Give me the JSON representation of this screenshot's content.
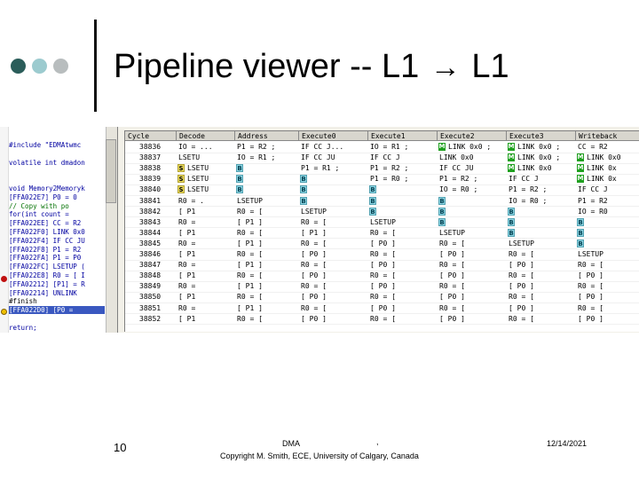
{
  "slide": {
    "title_left": "Pipeline viewer  -- L1",
    "title_arrow": "→",
    "title_right": "L1",
    "dot_colors": [
      "#2b5d5a",
      "#9ccbcf",
      "#b8bdbe"
    ]
  },
  "editor": {
    "lines": [
      {
        "text": "#include \"EDMAtwmc",
        "style": "blue"
      },
      {
        "text": "",
        "style": ""
      },
      {
        "text": "volatile int dmadon",
        "style": "blue"
      },
      {
        "text": "",
        "style": ""
      },
      {
        "text": "",
        "style": ""
      },
      {
        "text": "void Memory2Memoryk",
        "style": "blue"
      },
      {
        "text": "[FFA022E7] P0 = 0",
        "style": "blue"
      },
      {
        "text": "   // Copy with po",
        "style": "green"
      },
      {
        "text": "   for(int count =",
        "style": "blue"
      },
      {
        "text": "[FFA022EE] CC = R2",
        "style": "blue"
      },
      {
        "text": "[FFA022F0] LINK 0x0",
        "style": "blue"
      },
      {
        "text": "[FFA022F4] IF CC JU",
        "style": "blue"
      },
      {
        "text": "[FFA022F8] P1 = R2",
        "style": "blue"
      },
      {
        "text": "[FFA022FA] P1 = P0",
        "style": "blue"
      },
      {
        "text": "[FFA022FC] LSETUP (",
        "style": "blue"
      },
      {
        "text": "[FFA022E8] R0 = [ I",
        "style": "blue"
      },
      {
        "text": "[FFA02212] [P1] = R",
        "style": "blue"
      },
      {
        "text": "[FFA02214] UNLINK",
        "style": "blue"
      },
      {
        "text": "   #finish",
        "style": ""
      },
      {
        "text": "[FFA022D0] [P0 = ",
        "style": "sel"
      },
      {
        "text": "",
        "style": ""
      },
      {
        "text": "   return;",
        "style": "blue"
      }
    ]
  },
  "pipeline": {
    "headers": [
      "Cycle",
      "Decode",
      "Address",
      "Execute0",
      "Execute1",
      "Execute2",
      "Execute3",
      "Writeback"
    ],
    "rows": [
      {
        "cycle": "38836",
        "tags": [
          "",
          "",
          "",
          "",
          "",
          "M",
          "M",
          ""
        ],
        "cells": [
          "",
          "IO = ...",
          "P1 = R2 ;",
          "IF CC J...",
          "IO = R1 ;",
          "LINK 0x0 ;",
          "LINK 0x0 ;",
          "CC = R2"
        ]
      },
      {
        "cycle": "38837",
        "tags": [
          "",
          "",
          "",
          "",
          "",
          "",
          "M",
          "M"
        ],
        "cells": [
          "",
          "LSETU",
          "IO = R1 ;",
          "IF CC JU",
          "IF CC J",
          "LINK 0x0",
          "LINK 0x0 ;",
          "LINK 0x0"
        ]
      },
      {
        "cycle": "38838",
        "tags": [
          "",
          "S",
          "B",
          "",
          "",
          "",
          "M",
          "M"
        ],
        "cells": [
          "",
          "LSETU",
          "",
          "P1 = R1 ;",
          "P1 = R2 ;",
          "IF CC JU",
          "LINK 0x0",
          "LINK 0x"
        ]
      },
      {
        "cycle": "38839",
        "tags": [
          "",
          "S",
          "B",
          "B",
          "",
          "",
          "",
          "M"
        ],
        "cells": [
          "",
          "LSETU",
          "",
          "",
          "P1 = R0 ;",
          "P1 = R2 ;",
          "IF CC J",
          "LINK 0x"
        ]
      },
      {
        "cycle": "38840",
        "tags": [
          "",
          "S",
          "B",
          "B",
          "B",
          "",
          "",
          ""
        ],
        "cells": [
          "",
          "LSETU",
          "",
          "",
          "",
          "IO = R0 ;",
          "P1 = R2 ;",
          "IF CC J"
        ]
      },
      {
        "cycle": "38841",
        "tags": [
          "",
          "",
          "",
          "B",
          "B",
          "B",
          "",
          ""
        ],
        "cells": [
          "",
          "R0 = .",
          "LSETUP",
          "",
          "",
          "",
          "IO = R0 ;",
          "P1 = R2"
        ]
      },
      {
        "cycle": "38842",
        "tags": [
          "",
          "",
          "",
          "",
          "B",
          "B",
          "B",
          ""
        ],
        "cells": [
          "",
          "[ P1",
          "R0 = [",
          "LSETUP",
          "",
          "",
          "",
          "IO = R0"
        ]
      },
      {
        "cycle": "38843",
        "tags": [
          "",
          "",
          "",
          "",
          "",
          "B",
          "B",
          "B"
        ],
        "cells": [
          "",
          "R0 =",
          "[ P1 ]",
          "R0 = [",
          "LSETUP",
          "",
          "",
          ""
        ]
      },
      {
        "cycle": "38844",
        "tags": [
          "",
          "",
          "",
          "",
          "",
          "",
          "B",
          "B"
        ],
        "cells": [
          "",
          "[ P1",
          "R0 = [",
          "[ P1 ]",
          "R0 = [",
          "LSETUP",
          "",
          ""
        ]
      },
      {
        "cycle": "38845",
        "tags": [
          "",
          "",
          "",
          "",
          "",
          "",
          "",
          "B"
        ],
        "cells": [
          "",
          "R0 =",
          "[ P1 ]",
          "R0 = [",
          "[ P0 ]",
          "R0 = [",
          "LSETUP",
          ""
        ]
      },
      {
        "cycle": "38846",
        "tags": [
          "",
          "",
          "",
          "",
          "",
          "",
          "",
          ""
        ],
        "cells": [
          "",
          "[ P1",
          "R0 = [",
          "[ P0 ]",
          "R0 = [",
          "[ P0 ]",
          "R0 = [",
          "LSETUP"
        ]
      },
      {
        "cycle": "38847",
        "tags": [
          "",
          "",
          "",
          "",
          "",
          "",
          "",
          ""
        ],
        "cells": [
          "",
          "R0 =",
          "[ P1 ]",
          "R0 = [",
          "[ P0 ]",
          "R0 = [",
          "[ P0 ]",
          "R0 = ["
        ]
      },
      {
        "cycle": "38848",
        "tags": [
          "",
          "",
          "",
          "",
          "",
          "",
          "",
          ""
        ],
        "cells": [
          "",
          "[ P1",
          "R0 = [",
          "[ P0 ]",
          "R0 = [",
          "[ P0 ]",
          "R0 = [",
          "[ P0 ]"
        ]
      },
      {
        "cycle": "38849",
        "tags": [
          "",
          "",
          "",
          "",
          "",
          "",
          "",
          ""
        ],
        "cells": [
          "",
          "R0 =",
          "[ P1 ]",
          "R0 = [",
          "[ P0 ]",
          "R0 = [",
          "[ P0 ]",
          "R0 = ["
        ]
      },
      {
        "cycle": "38850",
        "tags": [
          "",
          "",
          "",
          "",
          "",
          "",
          "",
          ""
        ],
        "cells": [
          "",
          "[ P1",
          "R0 = [",
          "[ P0 ]",
          "R0 = [",
          "[ P0 ]",
          "R0 = [",
          "[ P0 ]"
        ]
      },
      {
        "cycle": "38851",
        "tags": [
          "",
          "",
          "",
          "",
          "",
          "",
          "",
          ""
        ],
        "cells": [
          "",
          "R0 =",
          "[ P1 ]",
          "R0 = [",
          "[ P0 ]",
          "R0 = [",
          "[ P0 ]",
          "R0 = ["
        ]
      },
      {
        "cycle": "38852",
        "tags": [
          "",
          "",
          "",
          "",
          "",
          "",
          "",
          ""
        ],
        "cells": [
          "",
          "[ P1",
          "R0 = [",
          "[ P0 ]",
          "R0 = [",
          "[ P0 ]",
          "R0 = [",
          "[ P0 ]"
        ]
      }
    ]
  },
  "footer": {
    "page_number": "10",
    "center_line1": "DMA",
    "center_dot": ",",
    "center_line2": "Copyright M. Smith, ECE, University of Calgary, Canada",
    "date": "12/14/2021"
  }
}
